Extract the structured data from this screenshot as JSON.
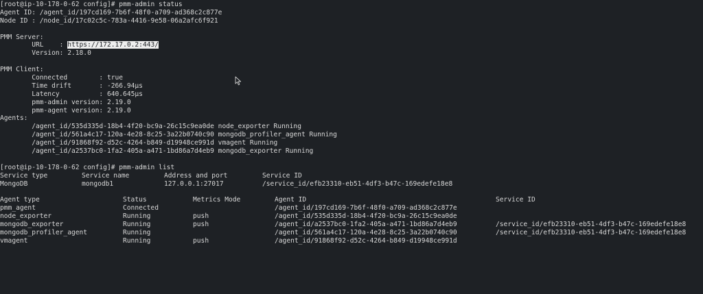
{
  "status_block": {
    "prompt": "[root@ip-10-178-0-62 config]# ",
    "command": "pmm-admin status",
    "agent_id": "Agent ID: /agent_id/197cd169-7b6f-48f0-a709-ad368c2c877e",
    "node_id": "Node ID : /node_id/17c02c5c-783a-4416-9e58-06a2afc6f921",
    "server_heading": "PMM Server:",
    "url_label": "        URL    : ",
    "url_value": "https://172.17.0.2:443/",
    "server_version": "        Version: 2.18.0",
    "client_heading": "PMM Client:",
    "client_lines": [
      "        Connected        : true",
      "        Time drift       : -266.94µs",
      "        Latency          : 640.645µs",
      "        pmm-admin version: 2.19.0",
      "        pmm-agent version: 2.19.0"
    ],
    "agents_heading": "Agents:",
    "agent_lines": [
      "        /agent_id/535d335d-18b4-4f20-bc9a-26c15c9ea0de node_exporter Running",
      "        /agent_id/561a4c17-120a-4e28-8c25-3a22b0740c90 mongodb_profiler_agent Running",
      "        /agent_id/91868f92-d52c-4264-b849-d19948ce991d vmagent Running",
      "        /agent_id/a2537bc0-1fa2-405a-a471-1bd86a7d4eb9 mongodb_exporter Running"
    ]
  },
  "list_block": {
    "prompt": "[root@ip-10-178-0-62 config]# ",
    "command": "pmm-admin list",
    "services_header": [
      "Service type",
      "Service name",
      "Address and port",
      "Service ID"
    ],
    "services": [
      [
        "MongoDB",
        "mongodb1",
        "127.0.0.1:27017",
        "/service_id/efb23310-eb51-4df3-b47c-169edefe18e8"
      ]
    ],
    "agents_header": [
      "Agent type",
      "Status",
      "Metrics Mode",
      "Agent ID",
      "Service ID"
    ],
    "agents": [
      [
        "pmm_agent",
        "Connected",
        "",
        "/agent_id/197cd169-7b6f-48f0-a709-ad368c2c877e",
        ""
      ],
      [
        "node_exporter",
        "Running",
        "push",
        "/agent_id/535d335d-18b4-4f20-bc9a-26c15c9ea0de",
        ""
      ],
      [
        "mongodb_exporter",
        "Running",
        "push",
        "/agent_id/a2537bc0-1fa2-405a-a471-1bd86a7d4eb9",
        "/service_id/efb23310-eb51-4df3-b47c-169edefe18e8"
      ],
      [
        "mongodb_profiler_agent",
        "Running",
        "",
        "/agent_id/561a4c17-120a-4e28-8c25-3a22b0740c90",
        "/service_id/efb23310-eb51-4df3-b47c-169edefe18e8"
      ],
      [
        "vmagent",
        "Running",
        "push",
        "/agent_id/91868f92-d52c-4264-b849-d19948ce991d",
        ""
      ]
    ]
  }
}
